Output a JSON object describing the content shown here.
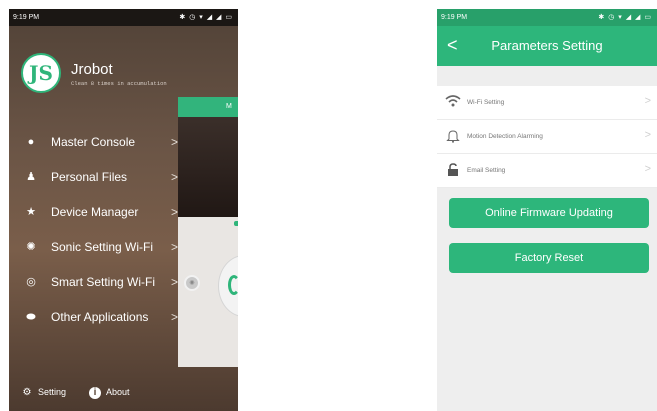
{
  "left_screen": {
    "status": {
      "time": "9:19 PM",
      "icons": "✱ ◷ ▾ ◢ ◢ ▭"
    },
    "logo_text": "JS",
    "app_name": "Jrobot",
    "tagline": "Clean 8 times in accumulation",
    "menu": [
      {
        "label": "Master Console",
        "arrow": ">",
        "icon": "console-icon"
      },
      {
        "label": "Personal Files",
        "arrow": ">",
        "icon": "people-icon"
      },
      {
        "label": "Device Manager",
        "arrow": ">",
        "icon": "star-icon"
      },
      {
        "label": "Sonic Setting Wi-Fi",
        "arrow": ">",
        "icon": "sonic-icon"
      },
      {
        "label": "Smart Setting Wi-Fi",
        "arrow": ">",
        "icon": "smart-wifi-icon"
      },
      {
        "label": "Other Applications",
        "arrow": ">",
        "icon": "apps-icon"
      }
    ],
    "peek_bar_text": "M",
    "bottom": {
      "setting_label": "Setting",
      "about_label": "About"
    }
  },
  "right_screen": {
    "status": {
      "time": "9:19 PM",
      "icons": "✱ ◷ ▾ ◢ ◢ ▭"
    },
    "title": "Parameters Setting",
    "back_symbol": "<",
    "rows": [
      {
        "label": "Wi-Fi Setting",
        "icon": "wifi-icon",
        "arrow": ">"
      },
      {
        "label": "Motion Detection Alarming",
        "icon": "bell-icon",
        "arrow": ">"
      },
      {
        "label": "Email Setting",
        "icon": "lock-icon",
        "arrow": ">"
      }
    ],
    "buttons": {
      "firmware": "Online Firmware Updating",
      "reset": "Factory Reset"
    }
  },
  "colors": {
    "accent": "#2db67b",
    "drawer_bg": "#6b5546"
  }
}
